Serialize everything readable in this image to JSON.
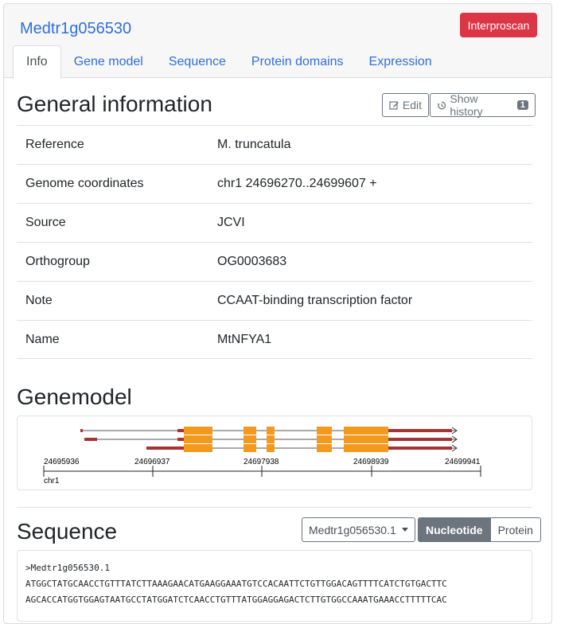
{
  "header": {
    "gene_id": "Medtr1g056530",
    "interproscan_label": "Interproscan",
    "tabs": [
      {
        "label": "Info",
        "active": true
      },
      {
        "label": "Gene model"
      },
      {
        "label": "Sequence"
      },
      {
        "label": "Protein domains"
      },
      {
        "label": "Expression"
      }
    ]
  },
  "general": {
    "title": "General information",
    "edit_label": "Edit",
    "history_label": "Show history",
    "history_count": "1",
    "rows": [
      {
        "key": "Reference",
        "value": "M. truncatula"
      },
      {
        "key": "Genome coordinates",
        "value": "chr1 24696270..24699607 +"
      },
      {
        "key": "Source",
        "value": "JCVI"
      },
      {
        "key": "Orthogroup",
        "value": "OG0003683"
      },
      {
        "key": "Note",
        "value": "CCAAT-binding transcription factor"
      },
      {
        "key": "Name",
        "value": "MtNFYA1"
      }
    ]
  },
  "genemodel": {
    "title": "Genemodel",
    "axis_ticks": [
      "24695936",
      "24696937",
      "24697938",
      "24698939",
      "24699941"
    ],
    "chromosome": "chr1",
    "colors": {
      "exon": "#f39a1e",
      "utr": "#a83232",
      "intron": "#555555"
    }
  },
  "sequence": {
    "title": "Sequence",
    "transcript_selected": "Medtr1g056530.1",
    "nucleotide_label": "Nucleotide",
    "protein_label": "Protein",
    "lines": [
      ">Medtr1g056530.1",
      "ATGGCTATGCAACCTGTTTATCTTAAAGAACATGAAGGAAATGTCCACAATTCTGTTGGACAGTTTTCATCTGTGACTTC",
      "AGCACCATGGTGGAGTAATGCCTATGGATCTCAACCTGTTTATGGAGGAGACTCTTGTGGCCAAATGAAACCTTTTTCAC"
    ]
  }
}
